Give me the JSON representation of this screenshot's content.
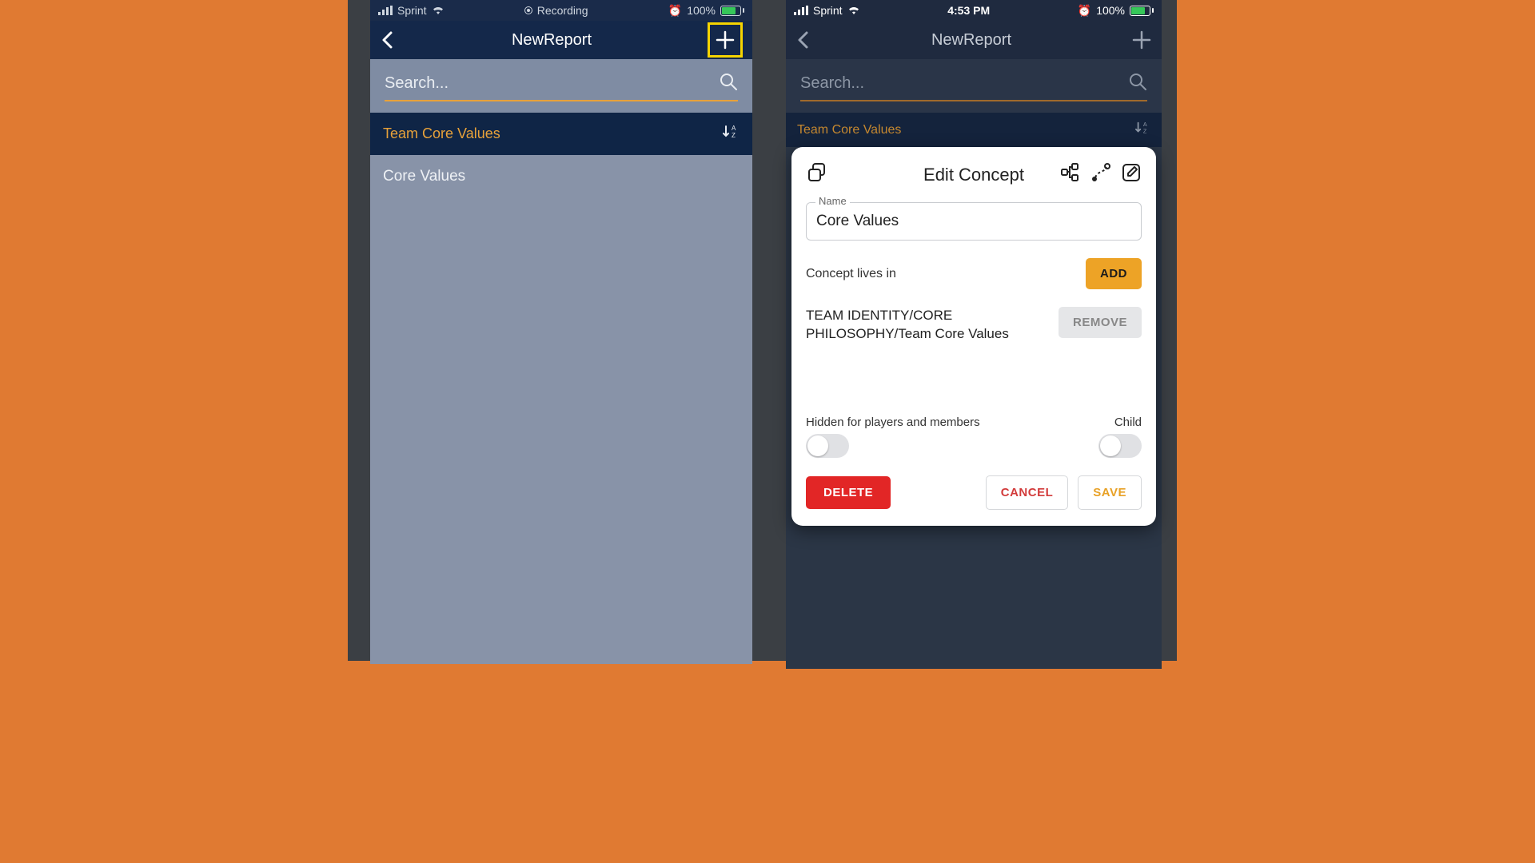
{
  "left": {
    "status": {
      "carrier": "Sprint",
      "center": "Recording",
      "battery_pct": "100%"
    },
    "nav": {
      "title": "NewReport"
    },
    "search": {
      "placeholder": "Search..."
    },
    "section": {
      "title": "Team Core Values"
    },
    "items": [
      "Core Values"
    ]
  },
  "right": {
    "status": {
      "carrier": "Sprint",
      "time": "4:53 PM",
      "battery_pct": "100%"
    },
    "nav": {
      "title": "NewReport"
    },
    "search": {
      "placeholder": "Search..."
    },
    "section": {
      "title": "Team Core Values"
    },
    "modal": {
      "title": "Edit Concept",
      "name_label": "Name",
      "name_value": "Core Values",
      "lives_in_label": "Concept lives in",
      "add_label": "ADD",
      "path_text": "TEAM IDENTITY/CORE PHILOSOPHY/Team Core Values",
      "remove_label": "REMOVE",
      "hidden_label": "Hidden for players and members",
      "child_label": "Child",
      "delete_label": "DELETE",
      "cancel_label": "CANCEL",
      "save_label": "SAVE"
    }
  }
}
